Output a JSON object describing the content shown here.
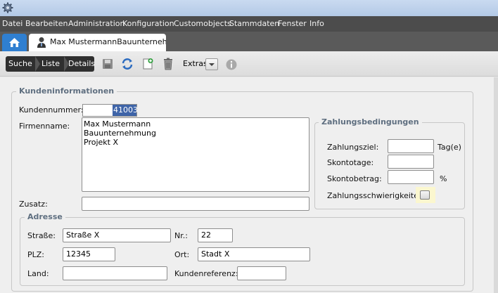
{
  "menu": [
    "Datei",
    "Bearbeiten",
    "Administration",
    "Konfiguration",
    "Customobjects",
    "Stammdaten",
    "Fenster",
    "Info"
  ],
  "tabs": {
    "home_icon": "home-icon",
    "document_tab_label": "Max MustermannBauunternehmung"
  },
  "toolbar": {
    "crumbs": [
      "Suche",
      "Liste",
      "Details"
    ],
    "icons": [
      "save-icon",
      "refresh-icon",
      "new-document-icon",
      "delete-icon"
    ],
    "extras_label": "Extras",
    "info_icon": "info-icon"
  },
  "kundeninformationen": {
    "legend": "Kundeninformationen",
    "kundennummer_label": "Kundennummer:",
    "kundennummer_value": "41003",
    "firmenname_label": "Firmenname:",
    "firmenname_lines": [
      "Max Mustermann",
      "Bauunternehmung",
      "Projekt X"
    ],
    "zusatz_label": "Zusatz:",
    "zusatz_value": ""
  },
  "zahlungsbedingungen": {
    "legend": "Zahlungsbedingungen",
    "zahlungsziel_label": "Zahlungsziel:",
    "zahlungsziel_value": "",
    "zahlungsziel_unit": "Tag(e)",
    "skontotage_label": "Skontotage:",
    "skontotage_value": "",
    "skontobetrag_label": "Skontobetrag:",
    "skontobetrag_value": "",
    "skontobetrag_unit": "%",
    "schwierigkeiten_label": "Zahlungsschwierigkeiten:",
    "schwierigkeiten_checked": false
  },
  "adresse": {
    "legend": "Adresse",
    "strasse_label": "Straße:",
    "strasse_value": "Straße X",
    "nr_label": "Nr.:",
    "nr_value": "22",
    "plz_label": "PLZ:",
    "plz_value": "12345",
    "ort_label": "Ort:",
    "ort_value": "Stadt X",
    "land_label": "Land:",
    "land_value": "",
    "kundenreferenz_label": "Kundenreferenz:",
    "kundenreferenz_value": ""
  }
}
